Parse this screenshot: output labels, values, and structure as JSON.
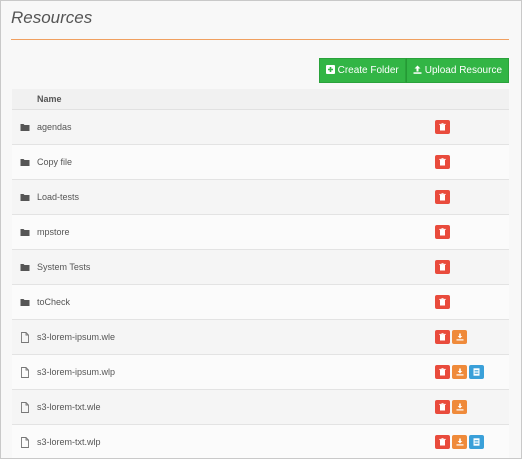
{
  "page": {
    "title": "Resources"
  },
  "toolbar": {
    "create_folder_label": "Create Folder",
    "upload_resource_label": "Upload Resource",
    "accent": "#32b545"
  },
  "table": {
    "header_name": "Name",
    "rows": [
      {
        "name": "agendas",
        "type": "folder",
        "actions": [
          "delete"
        ]
      },
      {
        "name": "Copy file",
        "type": "folder",
        "actions": [
          "delete"
        ]
      },
      {
        "name": "Load-tests",
        "type": "folder",
        "actions": [
          "delete"
        ]
      },
      {
        "name": "mpstore",
        "type": "folder",
        "actions": [
          "delete"
        ]
      },
      {
        "name": "System Tests",
        "type": "folder",
        "actions": [
          "delete"
        ]
      },
      {
        "name": "toCheck",
        "type": "folder",
        "actions": [
          "delete"
        ]
      },
      {
        "name": "s3-lorem-ipsum.wle",
        "type": "file",
        "actions": [
          "delete",
          "download"
        ]
      },
      {
        "name": "s3-lorem-ipsum.wlp",
        "type": "file",
        "actions": [
          "delete",
          "download",
          "preview"
        ]
      },
      {
        "name": "s3-lorem-txt.wle",
        "type": "file",
        "actions": [
          "delete",
          "download"
        ]
      },
      {
        "name": "s3-lorem-txt.wlp",
        "type": "file",
        "actions": [
          "delete",
          "download",
          "preview"
        ]
      }
    ]
  },
  "icons": {
    "folder": "folder-icon",
    "file": "file-icon",
    "delete": "trash-icon",
    "download": "download-icon",
    "preview": "document-icon"
  },
  "colors": {
    "delete": "#e94b3c",
    "download": "#ef8a3a",
    "preview": "#3aa0d9",
    "title_rule": "#f0a060"
  }
}
